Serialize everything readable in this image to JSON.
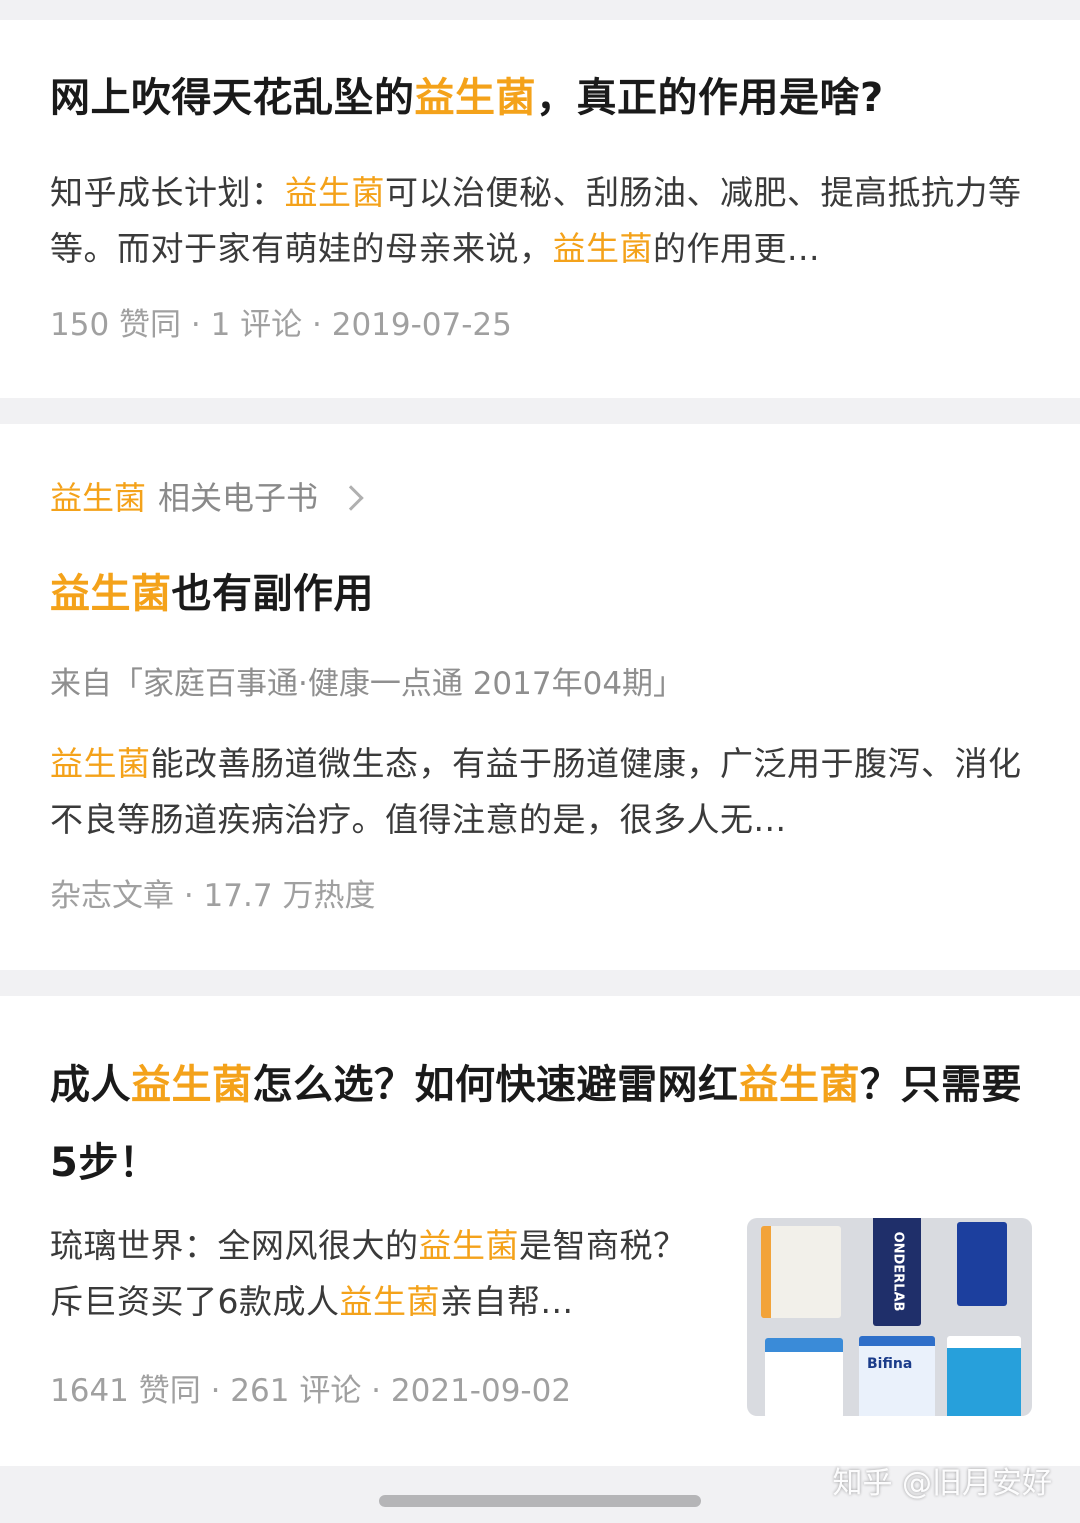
{
  "cards": [
    {
      "title": {
        "pre": "网上吹得天花乱坠的",
        "hl": "益生菌",
        "post": "，真正的作用是啥?"
      },
      "excerpt": {
        "a": "知乎成长计划：",
        "hl1": "益生菌",
        "b": "可以治便秘、刮肠油、减肥、提高抵抗力等等。而对于家有萌娃的母亲来说，",
        "hl2": "益生菌",
        "c": "的作用更..."
      },
      "meta": "150 赞同 · 1 评论 · 2019-07-25"
    },
    {
      "related": {
        "hl": "益生菌",
        "label": "相关电子书"
      },
      "title": {
        "hl": "益生菌",
        "post": "也有副作用"
      },
      "source": "来自「家庭百事通·健康一点通 2017年04期」",
      "excerpt": {
        "hl": "益生菌",
        "text": "能改善肠道微生态，有益于肠道健康，广泛用于腹泻、消化不良等肠道疾病治疗。值得注意的是，很多人无..."
      },
      "meta": "杂志文章 · 17.7 万热度"
    },
    {
      "title": {
        "a": "成人",
        "hl1": "益生菌",
        "b": "怎么选？如何快速避雷网红",
        "hl2": "益生菌",
        "c": "？只需要5步！"
      },
      "excerpt": {
        "a": "琉璃世界：全网风很大的",
        "hl1": "益生菌",
        "b": "是智商税？斥巨资买了6款成人",
        "hl2": "益生菌",
        "c": "亲自帮..."
      },
      "meta": "1641 赞同 · 261 评论 · 2021-09-02",
      "thumbnail": {
        "labels": [
          "ONDERLAB",
          "Bifina"
        ]
      }
    }
  ],
  "watermark": "知乎 @旧月安好",
  "colors": {
    "highlight": "#f4a21a",
    "meta": "#a0a0a0",
    "background": "#f1f1f3"
  }
}
